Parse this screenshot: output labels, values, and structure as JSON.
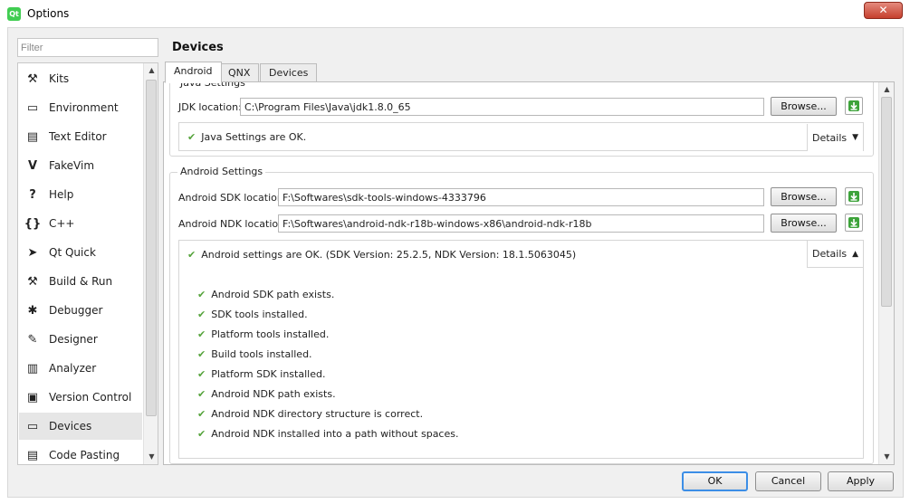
{
  "window": {
    "title": "Options",
    "app_icon": "qt-creator-icon",
    "close_glyph": "✕"
  },
  "filter": {
    "placeholder": "Filter"
  },
  "sidebar": {
    "items": [
      {
        "label": "Kits",
        "icon": "kits-icon",
        "glyph": "⚒"
      },
      {
        "label": "Environment",
        "icon": "monitor-icon",
        "glyph": "▭"
      },
      {
        "label": "Text Editor",
        "icon": "text-editor-icon",
        "glyph": "▤"
      },
      {
        "label": "FakeVim",
        "icon": "fakevim-icon",
        "glyph": "V"
      },
      {
        "label": "Help",
        "icon": "help-icon",
        "glyph": "?"
      },
      {
        "label": "C++",
        "icon": "cpp-icon",
        "glyph": "{}"
      },
      {
        "label": "Qt Quick",
        "icon": "qt-quick-icon",
        "glyph": "➤"
      },
      {
        "label": "Build & Run",
        "icon": "hammer-icon",
        "glyph": "⚒"
      },
      {
        "label": "Debugger",
        "icon": "bug-icon",
        "glyph": "✱"
      },
      {
        "label": "Designer",
        "icon": "pencil-icon",
        "glyph": "✎"
      },
      {
        "label": "Analyzer",
        "icon": "analyzer-icon",
        "glyph": "▥"
      },
      {
        "label": "Version Control",
        "icon": "version-control-icon",
        "glyph": "▣"
      },
      {
        "label": "Devices",
        "icon": "devices-icon",
        "glyph": "▭"
      },
      {
        "label": "Code Pasting",
        "icon": "clipboard-icon",
        "glyph": "▤"
      }
    ],
    "selected": "Devices"
  },
  "page": {
    "title": "Devices"
  },
  "tabs": [
    {
      "label": "Android"
    },
    {
      "label": "QNX"
    },
    {
      "label": "Devices"
    }
  ],
  "java": {
    "group_title": "Java Settings",
    "jdk_label": "JDK location:",
    "jdk_value": "C:\\Program Files\\Java\\jdk1.8.0_65",
    "browse_label": "Browse...",
    "status": "Java Settings are OK.",
    "details_label": "Details"
  },
  "android": {
    "group_title": "Android Settings",
    "sdk_label": "Android SDK location:",
    "sdk_value": "F:\\Softwares\\sdk-tools-windows-4333796",
    "ndk_label": "Android NDK location:",
    "ndk_value": "F:\\Softwares\\android-ndk-r18b-windows-x86\\android-ndk-r18b",
    "browse_label": "Browse...",
    "status": "Android settings are OK. (SDK Version: 25.2.5, NDK Version: 18.1.5063045)",
    "details_label": "Details",
    "checks": [
      "Android SDK path exists.",
      "SDK tools installed.",
      "Platform tools installed.",
      "Build tools installed.",
      "Platform SDK installed.",
      "Android NDK path exists.",
      "Android NDK directory structure is correct.",
      "Android NDK installed into a path without spaces."
    ]
  },
  "buttons": {
    "ok": "OK",
    "cancel": "Cancel",
    "apply": "Apply"
  },
  "colors": {
    "check_green": "#55a33b",
    "download_green": "#3da33a",
    "selected_bg": "#e6e6e6",
    "default_button_border": "#3c8ee6"
  }
}
